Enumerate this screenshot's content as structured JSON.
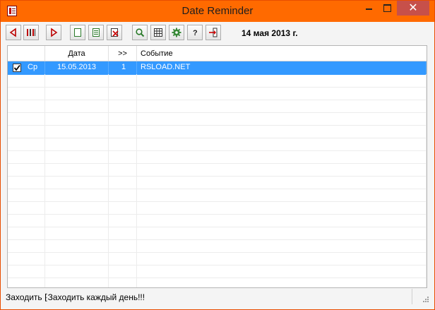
{
  "window": {
    "title": "Date Reminder"
  },
  "toolbar": {
    "buttons": [
      {
        "name": "prev-day-button",
        "icon": "triangle-left-icon"
      },
      {
        "name": "today-button",
        "icon": "calendar-bars-icon"
      },
      {
        "name": "next-day-button",
        "icon": "triangle-right-icon"
      },
      {
        "name": "new-button",
        "icon": "blank-page-icon"
      },
      {
        "name": "edit-button",
        "icon": "lined-page-icon"
      },
      {
        "name": "delete-button",
        "icon": "page-x-icon"
      },
      {
        "name": "search-button",
        "icon": "magnifier-icon"
      },
      {
        "name": "calendar-button",
        "icon": "calendar-grid-icon"
      },
      {
        "name": "settings-button",
        "icon": "gear-icon"
      },
      {
        "name": "help-button",
        "icon": "question-icon"
      },
      {
        "name": "exit-button",
        "icon": "exit-door-icon"
      }
    ],
    "current_date": "14 мая 2013 г."
  },
  "table": {
    "headers": [
      "",
      "Дата",
      ">>",
      "Событие"
    ],
    "rows": [
      {
        "checked": true,
        "day": "Ср",
        "date": "15.05.2013",
        "days": "1",
        "event": "RSLOAD.NET"
      }
    ]
  },
  "statusbar": {
    "text": "Заходить ⁅Заходить каждый день!!!"
  },
  "colors": {
    "titlebar": "#ff6a00",
    "close": "#c7504a",
    "selection": "#3399ff"
  }
}
